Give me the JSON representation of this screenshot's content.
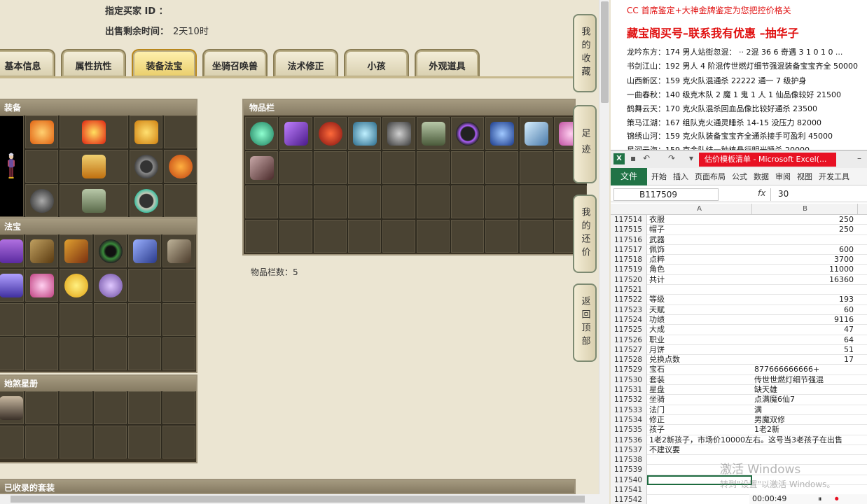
{
  "header": {
    "buyer_label": "指定买家 ID ：",
    "time_label": "出售剩余时间：",
    "time_value": "2天10时"
  },
  "tabs": [
    {
      "label": "基本信息"
    },
    {
      "label": "属性抗性"
    },
    {
      "label": "装备法宝",
      "active": true
    },
    {
      "label": "坐骑召唤兽"
    },
    {
      "label": "法术修正"
    },
    {
      "label": "小孩"
    },
    {
      "label": "外观道具"
    }
  ],
  "panels": {
    "equip_title": "装备",
    "treasure_title": "法宝",
    "stars_title": "她煞星册",
    "items_title": "物品栏",
    "items_count_label": "物品栏数：5",
    "collected_title": "已收录的套装"
  },
  "side_buttons": [
    {
      "label": "我的收藏"
    },
    {
      "label": "足迹"
    },
    {
      "label": "我的还价"
    },
    {
      "label": "返回顶部"
    }
  ],
  "notes": {
    "line0": "CC 首席鉴定+大神金牌鉴定为您把控价格关",
    "title": "藏宝阁买号–联系我有优惠 –抽华子",
    "lines": [
      "龙吟东方：174 男人站街忽混：  ·· 2混 36 6 奇遇 3 1 0 1 0 ...",
      "书剑江山：192 男人 4 阶混传世燃灯细节强混装备宝宝齐全 50000",
      "山西新区：159 克火队混通杀 22222 通一 7 级护身",
      "一曲春秋：140 级克木队 2 魔 1 鬼 1 人 1 仙品像较好 21500",
      "鹤舞云天：170 克火队混杀回血品像比较好通杀 23500",
      "策马江湖：167 组队克火通灵睡杀 14-15 没压力 82000",
      "锦绣山河：159 克火队装备宝宝齐全通杀接手可盈利 45000",
      "星河云海：159 克金队结一种植悬行明光睡杀 20000"
    ]
  },
  "excel": {
    "doc_title": "估价模板清单 - Microsoft Excel(...",
    "ribbon": [
      "开始",
      "插入",
      "页面布局",
      "公式",
      "数据",
      "审阅",
      "视图",
      "开发工具"
    ],
    "file_label": "文件",
    "name_box": "B117509",
    "fx_label": "fx",
    "formula_value": "30",
    "col_a": "A",
    "col_b": "B",
    "rows": [
      {
        "n": "117514",
        "a": "衣服",
        "b": "250",
        "num": true
      },
      {
        "n": "117515",
        "a": "帽子",
        "b": "250",
        "num": true
      },
      {
        "n": "117516",
        "a": "武器",
        "b": ""
      },
      {
        "n": "117517",
        "a": "佩饰",
        "b": "600",
        "num": true
      },
      {
        "n": "117518",
        "a": "点粹",
        "b": "3700",
        "num": true
      },
      {
        "n": "117519",
        "a": "角色",
        "b": "11000",
        "num": true
      },
      {
        "n": "117520",
        "a": "共计",
        "b": "16360",
        "num": true
      },
      {
        "n": "117521",
        "a": "",
        "b": ""
      },
      {
        "n": "117522",
        "a": "等级",
        "b": "193",
        "num": true
      },
      {
        "n": "117523",
        "a": "天赋",
        "b": "60",
        "num": true
      },
      {
        "n": "117524",
        "a": "功绩",
        "b": "9116",
        "num": true
      },
      {
        "n": "117525",
        "a": "大成",
        "b": "47",
        "num": true
      },
      {
        "n": "117526",
        "a": "职业",
        "b": "64",
        "num": true
      },
      {
        "n": "117527",
        "a": "月饼",
        "b": "51",
        "num": true
      },
      {
        "n": "117528",
        "a": "兑换点数",
        "b": "17",
        "num": true
      },
      {
        "n": "117529",
        "a": "宝石",
        "b": "877666666666+"
      },
      {
        "n": "117530",
        "a": "套装",
        "b": "传世世燃灯细节强混"
      },
      {
        "n": "117531",
        "a": "星盘",
        "b": "缺天雄"
      },
      {
        "n": "117532",
        "a": "坐骑",
        "b": "点满魔6仙7"
      },
      {
        "n": "117533",
        "a": "法门",
        "b": "满"
      },
      {
        "n": "117534",
        "a": "修正",
        "b": "男魔双修"
      },
      {
        "n": "117535",
        "a": "孩子",
        "b": "1老2新"
      },
      {
        "n": "117536",
        "a": "1老2新孩子，市场价10000左右。这号当3老孩子在出售",
        "b": ""
      },
      {
        "n": "117537",
        "a": "不建议要",
        "b": ""
      },
      {
        "n": "117538",
        "a": "",
        "b": ""
      },
      {
        "n": "117539",
        "a": "",
        "b": ""
      },
      {
        "n": "117540",
        "a": "",
        "b": "",
        "selected": true
      },
      {
        "n": "117541",
        "a": "",
        "b": ""
      },
      {
        "n": "117542",
        "a": "",
        "b": ""
      }
    ]
  },
  "windows_watermark": {
    "line1": "激活 Windows",
    "line2": "转到\"设置\"以激活 Windows。"
  },
  "recorder": {
    "time": "00:00:49"
  },
  "icon_colors": {
    "fire": "#f06a0f",
    "gold": "#e0b020",
    "teal": "#3fbfa0",
    "purple": "#8d3fd0",
    "red": "#d02020",
    "ice": "#7ec8ff",
    "pink": "#ff8ad8",
    "brown": "#7a5530"
  }
}
